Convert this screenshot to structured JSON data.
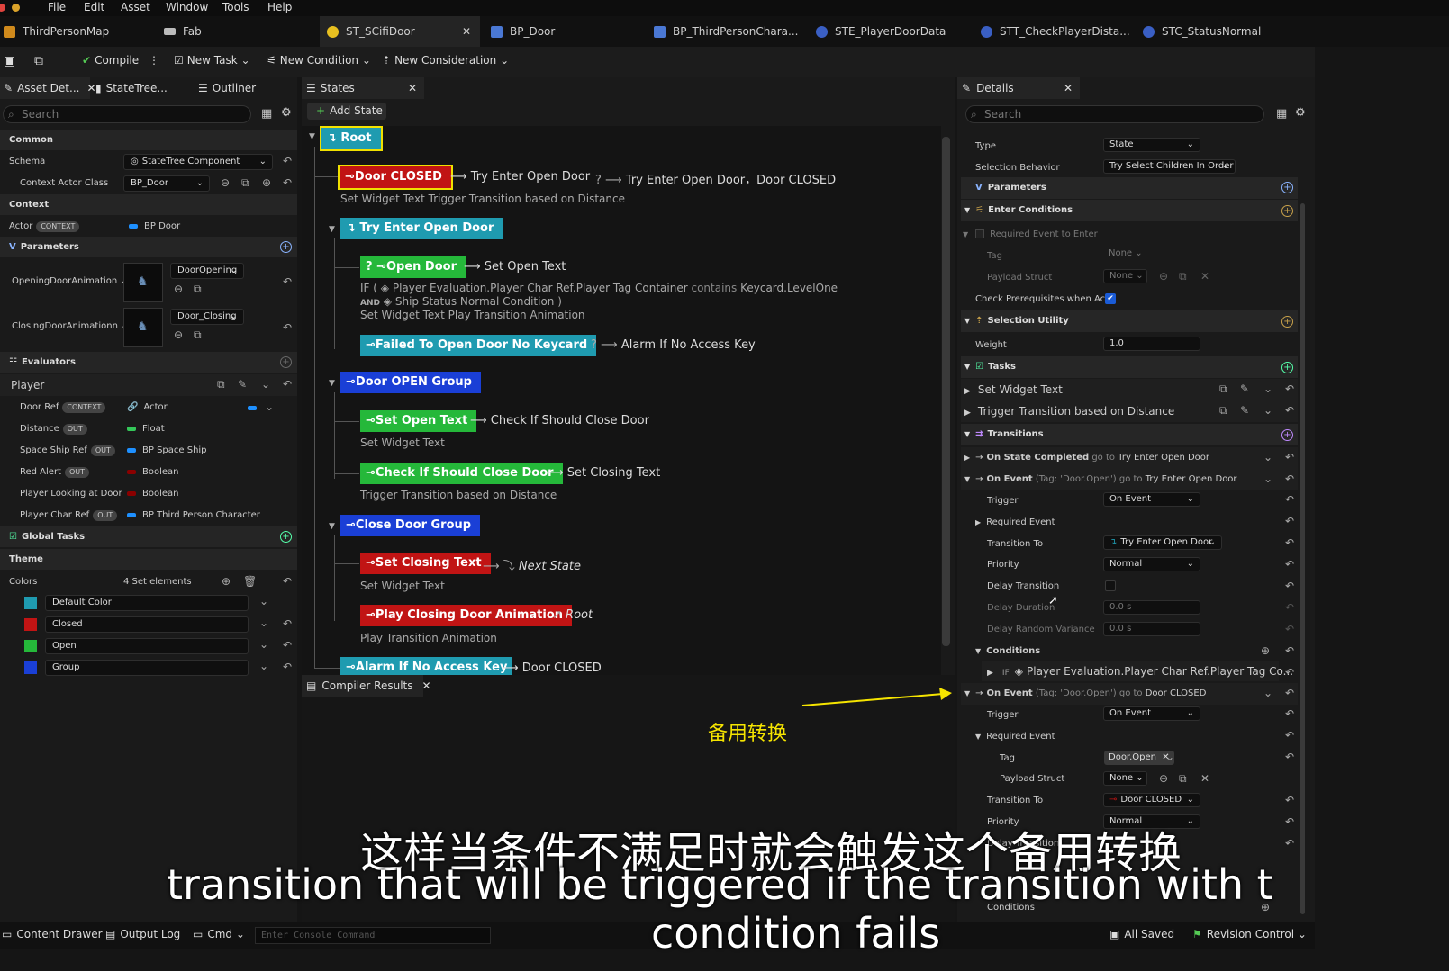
{
  "menu": [
    "File",
    "Edit",
    "Asset",
    "Window",
    "Tools",
    "Help"
  ],
  "doc_tabs": {
    "t1": "ThirdPersonMap",
    "t2": "Fab",
    "t3": "ST_SCifiDoor",
    "t4": "BP_Door",
    "t5": "BP_ThirdPersonChara...",
    "t6": "STE_PlayerDoorData",
    "t7": "STT_CheckPlayerDista...",
    "t8": "STC_StatusNormal"
  },
  "toolbar": {
    "compile": "Compile",
    "new_task": "New Task",
    "new_condition": "New Condition",
    "new_consideration": "New Consideration"
  },
  "left": {
    "tabs": {
      "asset_details": "Asset Det...",
      "statetree": "StateTree...",
      "outliner": "Outliner"
    },
    "search_placeholder": "Search",
    "common": "Common",
    "schema_label": "Schema",
    "schema_value": "StateTree Component",
    "context_actor_class_label": "Context Actor Class",
    "context_actor_class_value": "BP_Door",
    "context": "Context",
    "actor_label": "Actor",
    "context_badge": "CONTEXT",
    "actor_value": "BP Door",
    "parameters": "Parameters",
    "opening_label": "OpeningDoorAnimation",
    "opening_value": "DoorOpening",
    "closing_label": "ClosingDoorAnimationn",
    "closing_value": "Door_Closing",
    "evaluators": "Evaluators",
    "player": "Player",
    "player_rows": [
      {
        "name": "Door Ref",
        "badge": "CONTEXT",
        "type": "Actor"
      },
      {
        "name": "Distance",
        "badge": "OUT",
        "type": "Float"
      },
      {
        "name": "Space Ship Ref",
        "badge": "OUT",
        "type": "BP Space Ship"
      },
      {
        "name": "Red Alert",
        "badge": "OUT",
        "type": "Boolean"
      },
      {
        "name": "Player Looking at Door",
        "badge": "",
        "type": "Boolean"
      },
      {
        "name": "Player Char Ref",
        "badge": "OUT",
        "type": "BP Third Person Character"
      }
    ],
    "global_tasks": "Global Tasks",
    "theme": "Theme",
    "colors_label": "Colors",
    "colors_count": "4 Set elements",
    "color_items": [
      {
        "name": "Default Color",
        "color": "#1f9bb0"
      },
      {
        "name": "Closed",
        "color": "#c11414"
      },
      {
        "name": "Open",
        "color": "#25b83a"
      },
      {
        "name": "Group",
        "color": "#1a3fd6"
      }
    ]
  },
  "states": {
    "tab": "States",
    "add_state": "Add State",
    "root": "Root",
    "door_closed": "Door CLOSED",
    "door_closed_trans1": "Try Enter Open Door",
    "door_closed_q": "?",
    "door_closed_trans2": "Try Enter Open Door，Door CLOSED",
    "door_closed_tasks": "Set Widget Text   Trigger Transition based on Distance",
    "try_enter": "Try Enter Open Door",
    "open_door": "Open Door",
    "open_door_trans": "Set Open Text",
    "cond_if": "IF (",
    "cond_text": "Player Evaluation.Player Char Ref.Player Tag Container",
    "cond_contains": "contains",
    "cond_tag": "Keycard.LevelOne",
    "cond_and": "AND",
    "cond_text2": "Ship Status Normal Condition )",
    "open_door_tasks": "Set Widget Text   Play Transition Animation",
    "failed": "Failed To  Open Door No Keycard",
    "failed_trans": "Alarm If No Access Key",
    "open_group": "Door OPEN Group",
    "set_open_text": "Set Open Text",
    "set_open_trans": "Check If Should Close Door",
    "set_open_tasks": "Set Widget Text",
    "check_close": "Check If Should Close Door",
    "check_close_trans": "Set Closing Text",
    "check_close_tasks": "Trigger Transition based on Distance",
    "close_group": "Close Door Group",
    "set_closing": "Set Closing Text",
    "set_closing_trans": "Next State",
    "set_closing_tasks": "Set Widget Text",
    "play_closing": "Play Closing Door Animation",
    "play_closing_trans": "Root",
    "play_closing_tasks": "Play Transition Animation",
    "alarm": "Alarm If No Access Key",
    "alarm_trans": "Door CLOSED",
    "compiler_results": "Compiler Results"
  },
  "details": {
    "tab": "Details",
    "search_placeholder": "Search",
    "type_label": "Type",
    "type_value": "State",
    "selection_label": "Selection Behavior",
    "selection_value": "Try Select Children In Order",
    "parameters": "Parameters",
    "enter_conditions": "Enter Conditions",
    "required_event_to_enter": "Required Event to Enter",
    "tag_label": "Tag",
    "tag_value": "None",
    "payload_label": "Payload Struct",
    "payload_value": "None",
    "check_prereq": "Check Prerequisites when Ac...",
    "selection_utility": "Selection Utility",
    "weight_label": "Weight",
    "weight_value": "1.0",
    "tasks": "Tasks",
    "task1": "Set Widget Text",
    "task2": "Trigger Transition based on Distance",
    "transitions": "Transitions",
    "on_state_completed": "On State Completed",
    "go_to": "go to",
    "state_completed_target": "Try Enter Open Door",
    "on_event": "On Event",
    "on_event_tag": "(Tag: 'Door.Open')",
    "on_event1_target": "Try Enter Open Door",
    "trigger_label": "Trigger",
    "trigger_value": "On Event",
    "required_event": "Required Event",
    "transition_to_label": "Transition To",
    "transition_to_value1": "Try Enter Open Door",
    "priority_label": "Priority",
    "priority_value": "Normal",
    "delay_transition": "Delay Transition",
    "delay_duration": "Delay Duration",
    "delay_duration_value": "0.0 s",
    "delay_random": "Delay Random Variance",
    "delay_random_value": "0.0 s",
    "conditions": "Conditions",
    "cond_if": "IF",
    "cond_row": "Player Evaluation.Player Char Ref.Player Tag Co...",
    "on_event2_target": "Door CLOSED",
    "tag2_value": "Door.Open",
    "transition_to_value2": "Door CLOSED"
  },
  "annotation": "备用转换",
  "caption_cn": "这样当条件不满足时就会触发这个备用转换",
  "caption_en1": "transition that will be triggered if the transition with t",
  "caption_en2": "condition fails",
  "statusbar": {
    "content_drawer": "Content Drawer",
    "output_log": "Output Log",
    "cmd": "Cmd",
    "console_placeholder": "Enter Console Command",
    "all_saved": "All Saved",
    "revision_control": "Revision Control"
  },
  "colors": {
    "closed": "#c11414",
    "open": "#25b83a",
    "group": "#1a3fd6",
    "default": "#1f9bb0",
    "annotation": "#f5e400"
  }
}
